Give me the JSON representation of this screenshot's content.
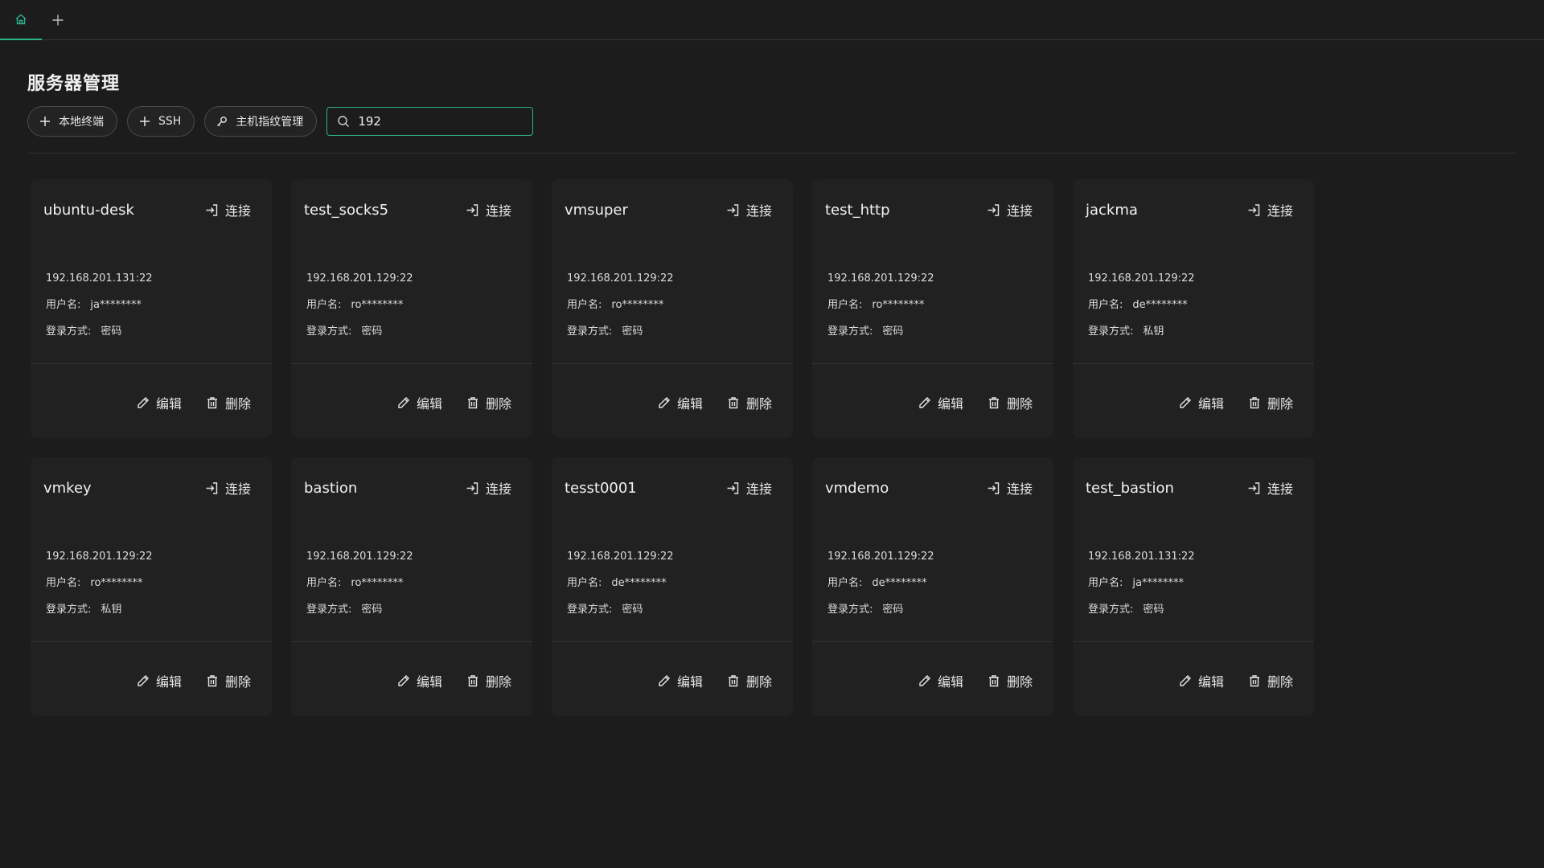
{
  "tabs": {
    "add_label": "+"
  },
  "page": {
    "title": "服务器管理"
  },
  "toolbar": {
    "local_terminal": "本地终端",
    "ssh": "SSH",
    "host_fingerprint": "主机指纹管理",
    "search_value": "192"
  },
  "labels": {
    "connect": "连接",
    "user": "用户名:",
    "login": "登录方式:",
    "edit": "编辑",
    "delete": "删除"
  },
  "servers": [
    {
      "name": "ubuntu-desk",
      "address": "192.168.201.131:22",
      "user": "ja********",
      "auth": "密码"
    },
    {
      "name": "test_socks5",
      "address": "192.168.201.129:22",
      "user": "ro********",
      "auth": "密码"
    },
    {
      "name": "vmsuper",
      "address": "192.168.201.129:22",
      "user": "ro********",
      "auth": "密码"
    },
    {
      "name": "test_http",
      "address": "192.168.201.129:22",
      "user": "ro********",
      "auth": "密码"
    },
    {
      "name": "jackma",
      "address": "192.168.201.129:22",
      "user": "de********",
      "auth": "私钥"
    },
    {
      "name": "vmkey",
      "address": "192.168.201.129:22",
      "user": "ro********",
      "auth": "私钥"
    },
    {
      "name": "bastion",
      "address": "192.168.201.129:22",
      "user": "ro********",
      "auth": "密码"
    },
    {
      "name": "tesst0001",
      "address": "192.168.201.129:22",
      "user": "de********",
      "auth": "密码"
    },
    {
      "name": "vmdemo",
      "address": "192.168.201.129:22",
      "user": "de********",
      "auth": "密码"
    },
    {
      "name": "test_bastion",
      "address": "192.168.201.131:22",
      "user": "ja********",
      "auth": "密码"
    }
  ],
  "colors": {
    "accent": "#2bb38a",
    "background": "#1c1c1c",
    "card": "#212121"
  }
}
